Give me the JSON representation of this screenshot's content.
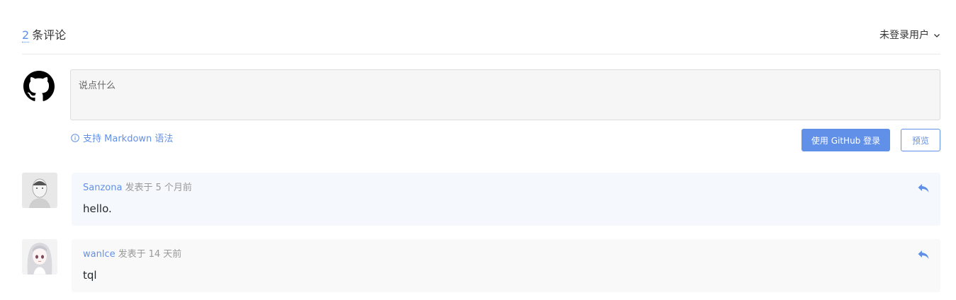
{
  "header": {
    "count": "2",
    "count_label": "条评论",
    "user_menu_label": "未登录用户"
  },
  "editor": {
    "placeholder": "说点什么",
    "markdown_tip": "支持 Markdown 语法",
    "login_button": "使用 GitHub 登录",
    "preview_button": "预览"
  },
  "comments": [
    {
      "author": "Sanzona",
      "action": "发表于",
      "time": "5 个月前",
      "body": "hello.",
      "bg": "#f5f9fe"
    },
    {
      "author": "wanlce",
      "action": "发表于",
      "time": "14 天前",
      "body": "tql",
      "bg": "#f9f9f9"
    }
  ],
  "colors": {
    "accent": "#6190e8",
    "muted": "#999999"
  }
}
